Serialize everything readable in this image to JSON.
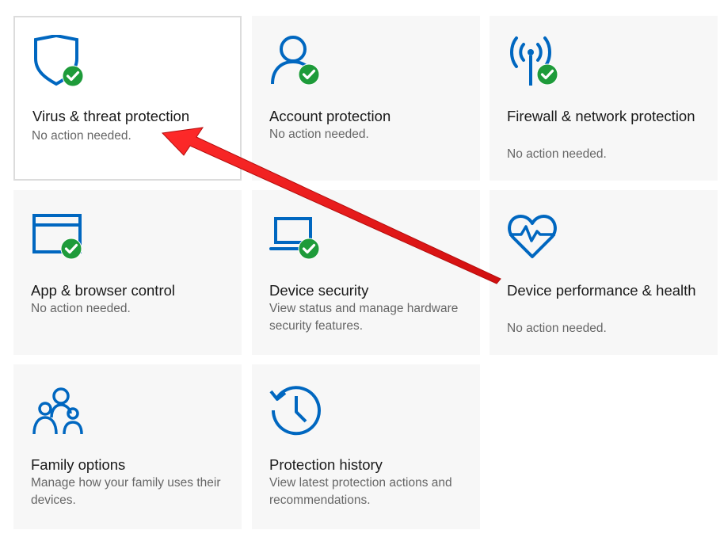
{
  "colors": {
    "accent": "#0067c0",
    "check": "#1e9b3a",
    "arrow": "#e11a1a"
  },
  "tiles": [
    {
      "icon": "shield-check-icon",
      "title": "Virus & threat protection",
      "subtitle": "No action needed."
    },
    {
      "icon": "account-check-icon",
      "title": "Account protection",
      "subtitle": "No action needed."
    },
    {
      "icon": "wifi-antenna-check-icon",
      "title": "Firewall & network protection",
      "subtitle": "No action needed."
    },
    {
      "icon": "browser-window-check-icon",
      "title": "App & browser control",
      "subtitle": "No action needed."
    },
    {
      "icon": "laptop-check-icon",
      "title": "Device security",
      "subtitle": "View status and manage hardware security features."
    },
    {
      "icon": "heart-pulse-icon",
      "title": "Device performance & health",
      "subtitle": "No action needed."
    },
    {
      "icon": "family-icon",
      "title": "Family options",
      "subtitle": "Manage how your family uses their devices."
    },
    {
      "icon": "history-clock-icon",
      "title": "Protection history",
      "subtitle": "View latest protection actions and recommendations."
    }
  ]
}
